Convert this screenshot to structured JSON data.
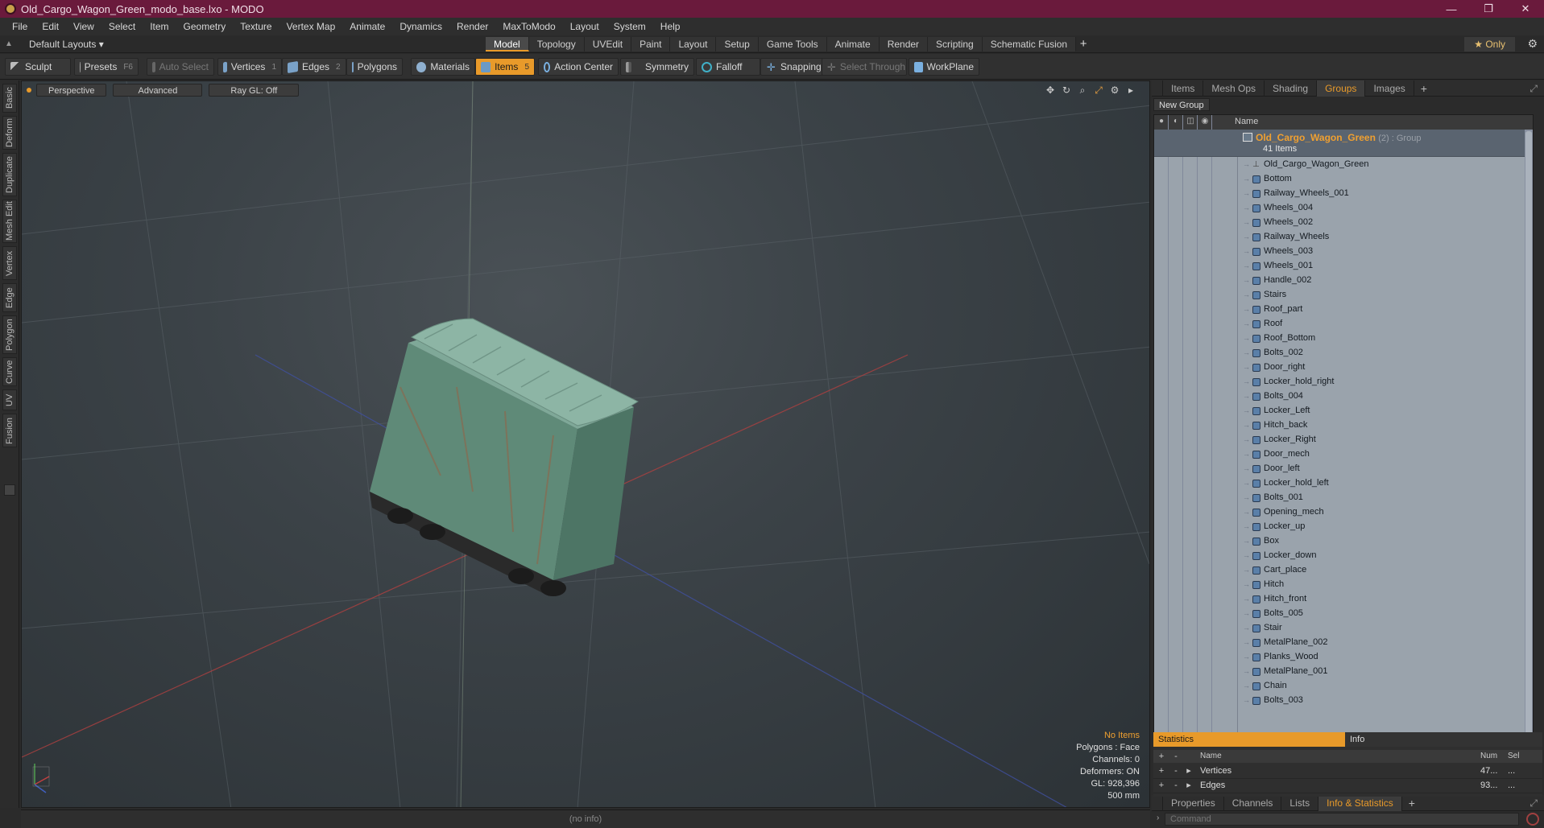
{
  "window": {
    "title": "Old_Cargo_Wagon_Green_modo_base.lxo - MODO",
    "controls": [
      "—",
      "❐",
      "✕"
    ]
  },
  "menu": [
    "File",
    "Edit",
    "View",
    "Select",
    "Item",
    "Geometry",
    "Texture",
    "Vertex Map",
    "Animate",
    "Dynamics",
    "Render",
    "MaxToModo",
    "Layout",
    "System",
    "Help"
  ],
  "layout_bar": {
    "layouts_label": "Default Layouts ▾",
    "tabs": [
      "Model",
      "Topology",
      "UVEdit",
      "Paint",
      "Layout",
      "Setup",
      "Game Tools",
      "Animate",
      "Render",
      "Scripting",
      "Schematic Fusion"
    ],
    "active_tab": "Model",
    "add": "+",
    "only_label": "★ Only"
  },
  "toolbar": {
    "sculpt": "Sculpt",
    "presets": "Presets",
    "presets_key": "F6",
    "auto_select": "Auto Select",
    "vertices": "Vertices",
    "vertices_key": "1",
    "edges": "Edges",
    "edges_key": "2",
    "polygons": "Polygons",
    "materials": "Materials",
    "items": "Items",
    "items_key": "5",
    "action_center": "Action Center",
    "symmetry": "Symmetry",
    "falloff": "Falloff",
    "snapping": "Snapping",
    "select_through": "Select Through",
    "workplane": "WorkPlane"
  },
  "left_tabs": [
    "Basic",
    "Deform",
    "Duplicate",
    "Mesh Edit",
    "Vertex",
    "Edge",
    "Polygon",
    "Curve",
    "UV",
    "Fusion"
  ],
  "viewport": {
    "view_mode": "Perspective",
    "shading": "Advanced",
    "raygl": "Ray GL: Off",
    "info": {
      "no_items": "No Items",
      "polygons": "Polygons : Face",
      "channels": "Channels: 0",
      "deformers": "Deformers: ON",
      "gl": "GL: 928,396",
      "scale": "500 mm"
    },
    "status": "(no info)"
  },
  "right_panel": {
    "top_tabs": [
      "Items",
      "Mesh Ops",
      "Shading",
      "Groups",
      "Images"
    ],
    "active_top_tab": "Groups",
    "new_group": "New Group",
    "list_header_name": "Name",
    "group": {
      "name": "Old_Cargo_Wagon_Green",
      "meta": "(2) : Group",
      "count": "41 Items"
    },
    "items": [
      "Old_Cargo_Wagon_Green",
      "Bottom",
      "Railway_Wheels_001",
      "Wheels_004",
      "Wheels_002",
      "Railway_Wheels",
      "Wheels_003",
      "Wheels_001",
      "Handle_002",
      "Stairs",
      "Roof_part",
      "Roof",
      "Roof_Bottom",
      "Bolts_002",
      "Door_right",
      "Locker_hold_right",
      "Bolts_004",
      "Locker_Left",
      "Hitch_back",
      "Locker_Right",
      "Door_mech",
      "Door_left",
      "Locker_hold_left",
      "Bolts_001",
      "Opening_mech",
      "Locker_up",
      "Box",
      "Locker_down",
      "Cart_place",
      "Hitch",
      "Hitch_front",
      "Bolts_005",
      "Stair",
      "MetalPlane_002",
      "Planks_Wood",
      "MetalPlane_001",
      "Chain",
      "Bolts_003"
    ],
    "bottom_tabs": [
      "Properties",
      "Channels",
      "Lists",
      "Info & Statistics"
    ],
    "active_bottom_tab": "Info & Statistics",
    "stats": {
      "tab_statistics": "Statistics",
      "tab_info": "Info",
      "col_name": "Name",
      "col_num": "Num",
      "col_sel": "Sel",
      "rows": [
        {
          "name": "Vertices",
          "num": "47...",
          "sel": "..."
        },
        {
          "name": "Edges",
          "num": "93...",
          "sel": "..."
        }
      ]
    },
    "command_placeholder": "Command"
  }
}
